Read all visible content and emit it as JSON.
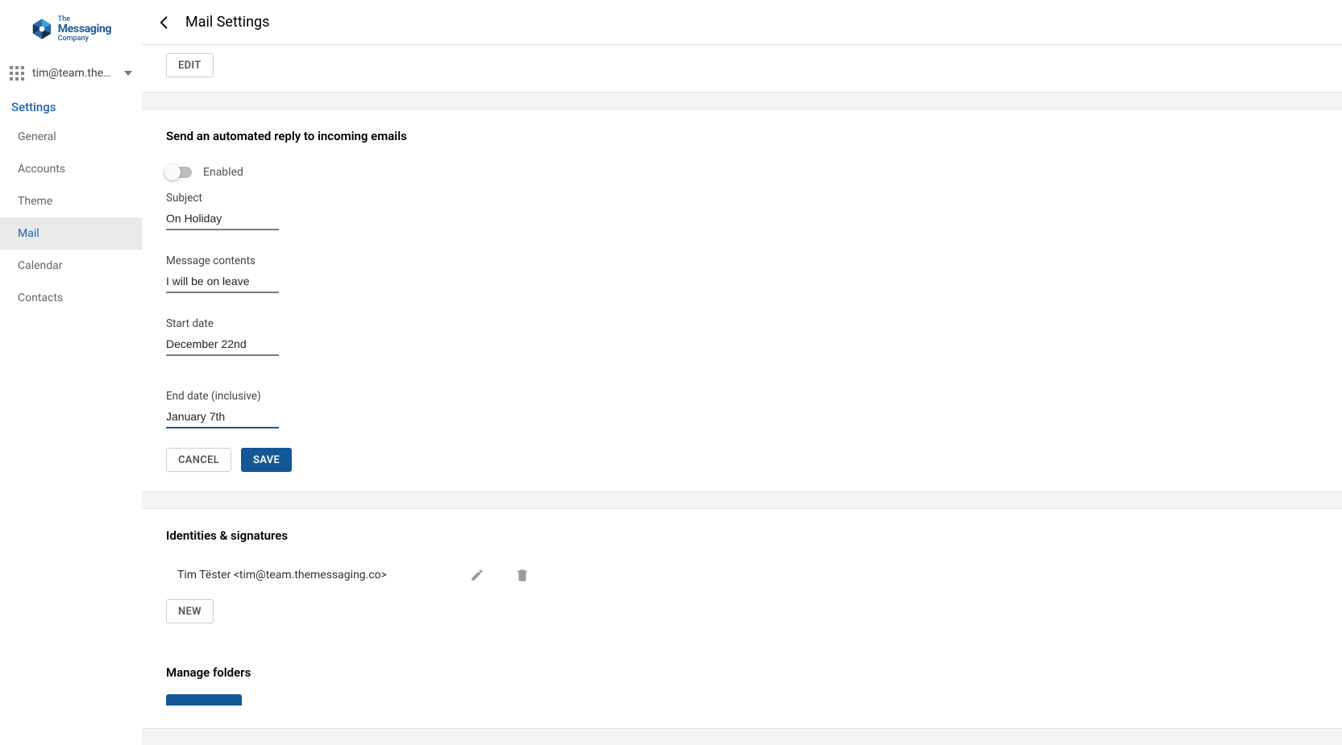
{
  "brand": {
    "line1": "The",
    "line2": "Messaging",
    "line3": "Company"
  },
  "account": {
    "email_truncated": "tim@team.the…"
  },
  "nav": {
    "title": "Settings",
    "items": [
      {
        "label": "General"
      },
      {
        "label": "Accounts"
      },
      {
        "label": "Theme"
      },
      {
        "label": "Mail"
      },
      {
        "label": "Calendar"
      },
      {
        "label": "Contacts"
      }
    ],
    "active_index": 3
  },
  "header": {
    "title": "Mail Settings"
  },
  "top_section": {
    "edit_label": "EDIT"
  },
  "auto_reply": {
    "title": "Send an automated reply to incoming emails",
    "enabled_label": "Enabled",
    "enabled": false,
    "subject_label": "Subject",
    "subject_value": "On Holiday",
    "message_label": "Message contents",
    "message_value": "I will be on leave",
    "start_label": "Start date",
    "start_value": "December 22nd",
    "end_label": "End date (inclusive)",
    "end_value": "January 7th",
    "cancel_label": "CANCEL",
    "save_label": "SAVE"
  },
  "identities": {
    "title": "Identities & signatures",
    "rows": [
      {
        "text": "Tim Tëster <tim@team.themessaging.co>"
      }
    ],
    "new_label": "NEW"
  },
  "folders": {
    "title": "Manage folders"
  }
}
